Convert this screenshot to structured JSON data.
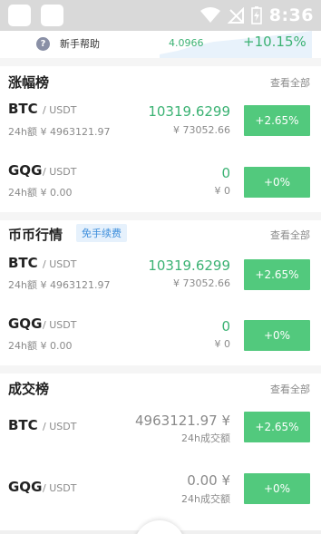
{
  "status_bar": {
    "time": "8:36"
  },
  "top_strip": {
    "help_label": "新手帮助",
    "help_icon_glyph": "?",
    "mini_price": "4.0966",
    "mini_change": "+10.15%"
  },
  "sections": {
    "gainers": {
      "title": "涨幅榜",
      "see_all": "查看全部",
      "rows": [
        {
          "symbol": "BTC",
          "quote": "/ USDT",
          "volume": "24h额 ¥ 4963121.97",
          "price": "10319.6299",
          "cny": "¥ 73052.66",
          "change": "+2.65%"
        },
        {
          "symbol": "GQG",
          "quote": "/ USDT",
          "volume": "24h额 ¥ 0.00",
          "price": "0",
          "cny": "¥ 0",
          "change": "+0%"
        }
      ]
    },
    "market": {
      "title": "币币行情",
      "badge": "免手续费",
      "see_all": "查看全部",
      "rows": [
        {
          "symbol": "BTC",
          "quote": "/ USDT",
          "volume": "24h额 ¥ 4963121.97",
          "price": "10319.6299",
          "cny": "¥ 73052.66",
          "change": "+2.65%"
        },
        {
          "symbol": "GQG",
          "quote": "/ USDT",
          "volume": "24h额 ¥ 0.00",
          "price": "0",
          "cny": "¥ 0",
          "change": "+0%"
        }
      ]
    },
    "volume_rank": {
      "title": "成交榜",
      "see_all": "查看全部",
      "rows": [
        {
          "symbol": "BTC",
          "quote": "/ USDT",
          "amount": "4963121.97 ¥",
          "amount_label": "24h成交额",
          "change": "+2.65%"
        },
        {
          "symbol": "GQG",
          "quote": "/ USDT",
          "amount": "0.00 ¥",
          "amount_label": "24h成交额",
          "change": "+0%"
        }
      ]
    }
  },
  "colors": {
    "up_green": "#52c97d",
    "price_green": "#3bb273",
    "badge_blue": "#3d8edb",
    "status_gray": "#d9d9d9"
  }
}
